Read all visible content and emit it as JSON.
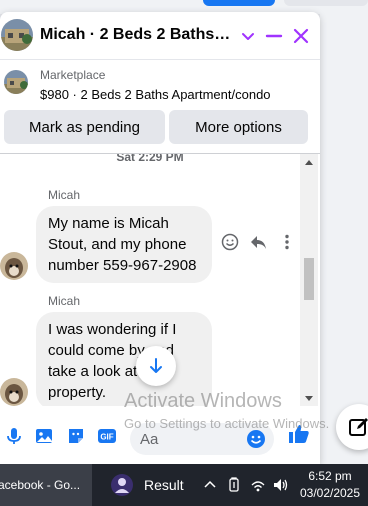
{
  "chat": {
    "title": "Micah · 2 Beds 2 Baths Ap...",
    "marketplace_label": "Marketplace",
    "listing": "$980 · 2 Beds 2 Baths Apartment/condo",
    "mark_pending": "Mark as pending",
    "more_options": "More options",
    "timestamp": "Sat 2:29 PM",
    "messages": [
      {
        "sender": "Micah",
        "text": "My name is Micah Stout, and my phone number 559-967-2908"
      },
      {
        "sender": "Micah",
        "text": "I was wondering if I could come by and take a look at the property."
      }
    ],
    "composer_placeholder": "Aa",
    "accent_color": "#1877f2",
    "close_color": "#a033ff"
  },
  "watermark": {
    "line1": "Activate Windows",
    "line2": "Go to Settings to activate Windows."
  },
  "taskbar": {
    "facebook_task": "acebook - Go...",
    "result_task": "Result",
    "time": "6:52 pm",
    "date": "03/02/2025"
  }
}
